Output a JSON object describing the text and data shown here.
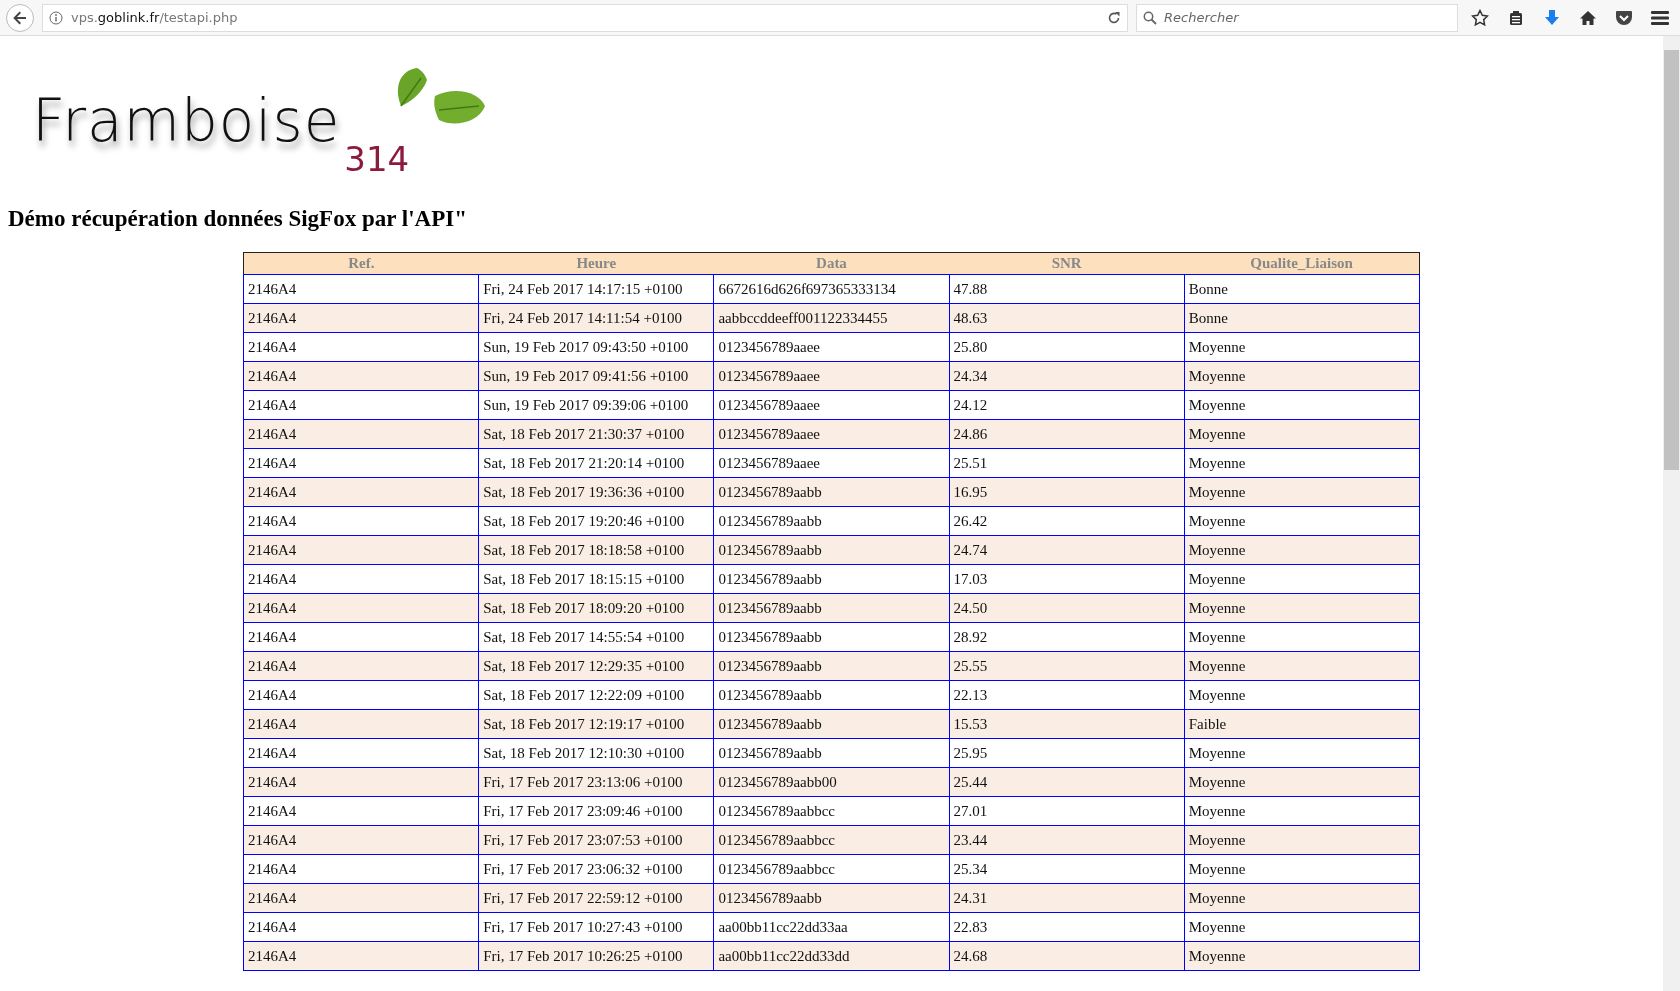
{
  "browser": {
    "url": {
      "prefix": "vps.",
      "domain": "goblink.fr",
      "path": "/testapi.php"
    },
    "search": {
      "placeholder": "Rechercher"
    }
  },
  "logo": {
    "name": "Framboise",
    "number": "314"
  },
  "heading": "Démo récupération données SigFox par l'API\"",
  "table": {
    "columns": [
      "Ref.",
      "Heure",
      "Data",
      "SNR",
      "Qualite_Liaison"
    ],
    "rows": [
      [
        "2146A4",
        "Fri, 24 Feb 2017 14:17:15 +0100",
        "6672616d626f697365333134",
        "47.88",
        "Bonne"
      ],
      [
        "2146A4",
        "Fri, 24 Feb 2017 14:11:54 +0100",
        "aabbccddeeff001122334455",
        "48.63",
        "Bonne"
      ],
      [
        "2146A4",
        "Sun, 19 Feb 2017 09:43:50 +0100",
        "0123456789aaee",
        "25.80",
        "Moyenne"
      ],
      [
        "2146A4",
        "Sun, 19 Feb 2017 09:41:56 +0100",
        "0123456789aaee",
        "24.34",
        "Moyenne"
      ],
      [
        "2146A4",
        "Sun, 19 Feb 2017 09:39:06 +0100",
        "0123456789aaee",
        "24.12",
        "Moyenne"
      ],
      [
        "2146A4",
        "Sat, 18 Feb 2017 21:30:37 +0100",
        "0123456789aaee",
        "24.86",
        "Moyenne"
      ],
      [
        "2146A4",
        "Sat, 18 Feb 2017 21:20:14 +0100",
        "0123456789aaee",
        "25.51",
        "Moyenne"
      ],
      [
        "2146A4",
        "Sat, 18 Feb 2017 19:36:36 +0100",
        "0123456789aabb",
        "16.95",
        "Moyenne"
      ],
      [
        "2146A4",
        "Sat, 18 Feb 2017 19:20:46 +0100",
        "0123456789aabb",
        "26.42",
        "Moyenne"
      ],
      [
        "2146A4",
        "Sat, 18 Feb 2017 18:18:58 +0100",
        "0123456789aabb",
        "24.74",
        "Moyenne"
      ],
      [
        "2146A4",
        "Sat, 18 Feb 2017 18:15:15 +0100",
        "0123456789aabb",
        "17.03",
        "Moyenne"
      ],
      [
        "2146A4",
        "Sat, 18 Feb 2017 18:09:20 +0100",
        "0123456789aabb",
        "24.50",
        "Moyenne"
      ],
      [
        "2146A4",
        "Sat, 18 Feb 2017 14:55:54 +0100",
        "0123456789aabb",
        "28.92",
        "Moyenne"
      ],
      [
        "2146A4",
        "Sat, 18 Feb 2017 12:29:35 +0100",
        "0123456789aabb",
        "25.55",
        "Moyenne"
      ],
      [
        "2146A4",
        "Sat, 18 Feb 2017 12:22:09 +0100",
        "0123456789aabb",
        "22.13",
        "Moyenne"
      ],
      [
        "2146A4",
        "Sat, 18 Feb 2017 12:19:17 +0100",
        "0123456789aabb",
        "15.53",
        "Faible"
      ],
      [
        "2146A4",
        "Sat, 18 Feb 2017 12:10:30 +0100",
        "0123456789aabb",
        "25.95",
        "Moyenne"
      ],
      [
        "2146A4",
        "Fri, 17 Feb 2017 23:13:06 +0100",
        "0123456789aabb00",
        "25.44",
        "Moyenne"
      ],
      [
        "2146A4",
        "Fri, 17 Feb 2017 23:09:46 +0100",
        "0123456789aabbcc",
        "27.01",
        "Moyenne"
      ],
      [
        "2146A4",
        "Fri, 17 Feb 2017 23:07:53 +0100",
        "0123456789aabbcc",
        "23.44",
        "Moyenne"
      ],
      [
        "2146A4",
        "Fri, 17 Feb 2017 23:06:32 +0100",
        "0123456789aabbcc",
        "25.34",
        "Moyenne"
      ],
      [
        "2146A4",
        "Fri, 17 Feb 2017 22:59:12 +0100",
        "0123456789aabb",
        "24.31",
        "Moyenne"
      ],
      [
        "2146A4",
        "Fri, 17 Feb 2017 10:27:43 +0100",
        "aa00bb11cc22dd33aa",
        "22.83",
        "Moyenne"
      ],
      [
        "2146A4",
        "Fri, 17 Feb 2017 10:26:25 +0100",
        "aa00bb11cc22dd33dd",
        "24.68",
        "Moyenne"
      ]
    ]
  }
}
